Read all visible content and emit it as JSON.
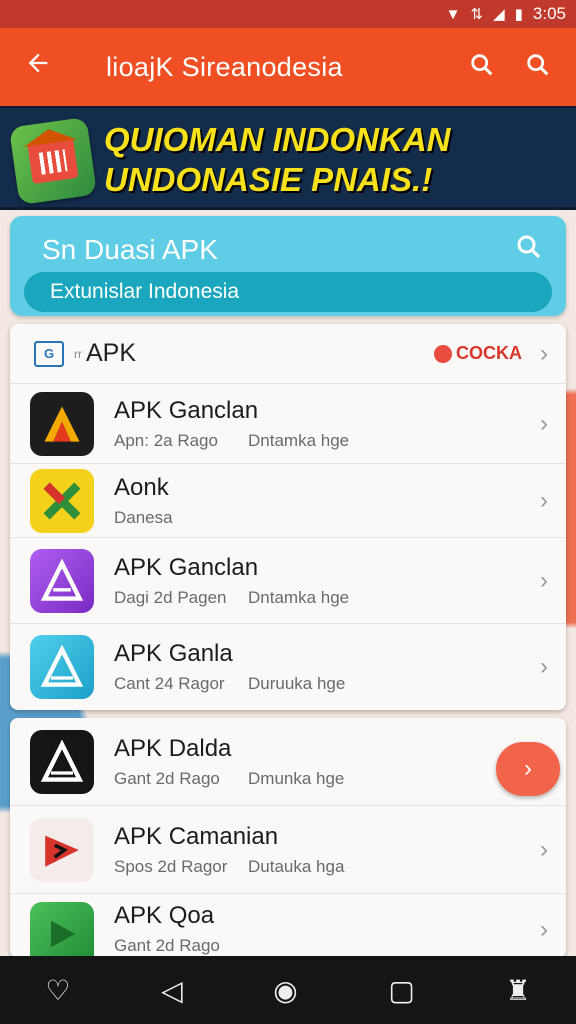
{
  "status_bar": {
    "time": "3:05",
    "icons": [
      "wifi-icon",
      "data-icon",
      "signal-icon",
      "battery-icon"
    ]
  },
  "app_bar": {
    "title": "lioajK Sireanodesia",
    "back_icon": "arrow-left-icon",
    "actions": [
      "search-icon",
      "search-icon"
    ]
  },
  "banner": {
    "line1": "QUIOMAN INDONKAN",
    "line2": "UNDONASIE PNAIS.!"
  },
  "search": {
    "placeholder": "Sn Duasi APK",
    "subtitle": "Extunislar Indonesia"
  },
  "list": {
    "header": {
      "small": "rr",
      "title": "APK",
      "link": "COCKA"
    },
    "items": [
      {
        "name": "APK Ganclan",
        "meta1": "Apn: 2a Rago",
        "meta2": "Dntamka hge",
        "icon": "apk-icon-black",
        "color": "#1d1d1d"
      },
      {
        "name": "Aonk",
        "meta1": "Danesa",
        "meta2": "",
        "icon": "apk-icon-green",
        "color": "#2f8f3b"
      },
      {
        "name": "APK Ganclan",
        "meta1": "Dagi 2d Pagen",
        "meta2": "Dntamka hge",
        "icon": "apk-icon-purple",
        "color": "#9b45d6"
      },
      {
        "name": "APK Ganla",
        "meta1": "Cant 24 Ragor",
        "meta2": "Duruuka hge",
        "icon": "apk-icon-cyan",
        "color": "#2ab6dc"
      },
      {
        "name": "APK Dalda",
        "meta1": "Gant 2d Rago",
        "meta2": "Dmunka hge",
        "icon": "apk-icon-black",
        "color": "#151515"
      },
      {
        "name": "APK Camanian",
        "meta1": "Spos 2d Ragor",
        "meta2": "Dutauka hga",
        "icon": "apk-icon-red",
        "color": "#f3ecea"
      },
      {
        "name": "APK Qoa",
        "meta1": "Gant 2d Rago",
        "meta2": "",
        "icon": "apk-icon-green",
        "color": "#2fa44a"
      }
    ]
  },
  "fab": {
    "icon": "chevron-right-icon"
  },
  "nav_bar": {
    "icons": [
      "heart-icon",
      "back-triangle-icon",
      "home-circle-icon",
      "recents-square-icon",
      "account-icon"
    ]
  }
}
